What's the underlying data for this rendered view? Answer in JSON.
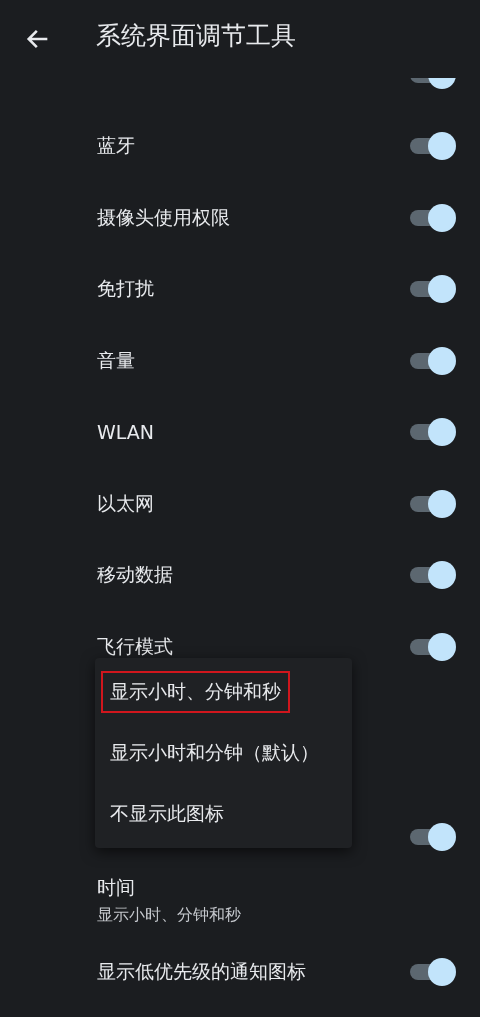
{
  "header": {
    "title": "系统界面调节工具"
  },
  "items": [
    {
      "kind": "clipped",
      "on": true
    },
    {
      "kind": "switch",
      "label": "蓝牙",
      "on": true
    },
    {
      "kind": "switch",
      "label": "摄像头使用权限",
      "on": true
    },
    {
      "kind": "switch",
      "label": "免打扰",
      "on": true
    },
    {
      "kind": "switch",
      "label": "音量",
      "on": true
    },
    {
      "kind": "switch",
      "label": "WLAN",
      "on": true
    },
    {
      "kind": "switch",
      "label": "以太网",
      "on": true
    },
    {
      "kind": "switch",
      "label": "移动数据",
      "on": true
    },
    {
      "kind": "switch",
      "label": "飞行模式",
      "on": true
    },
    {
      "kind": "covered",
      "on": true
    },
    {
      "kind": "summary",
      "label": "时间",
      "summary": "显示小时、分钟和秒"
    },
    {
      "kind": "switch",
      "label": "显示低优先级的通知图标",
      "on": true
    }
  ],
  "menu": {
    "options": [
      {
        "label": "显示小时、分钟和秒",
        "outlined": true
      },
      {
        "label": "显示小时和分钟（默认）",
        "outlined": false
      },
      {
        "label": "不显示此图标",
        "outlined": false
      }
    ]
  }
}
